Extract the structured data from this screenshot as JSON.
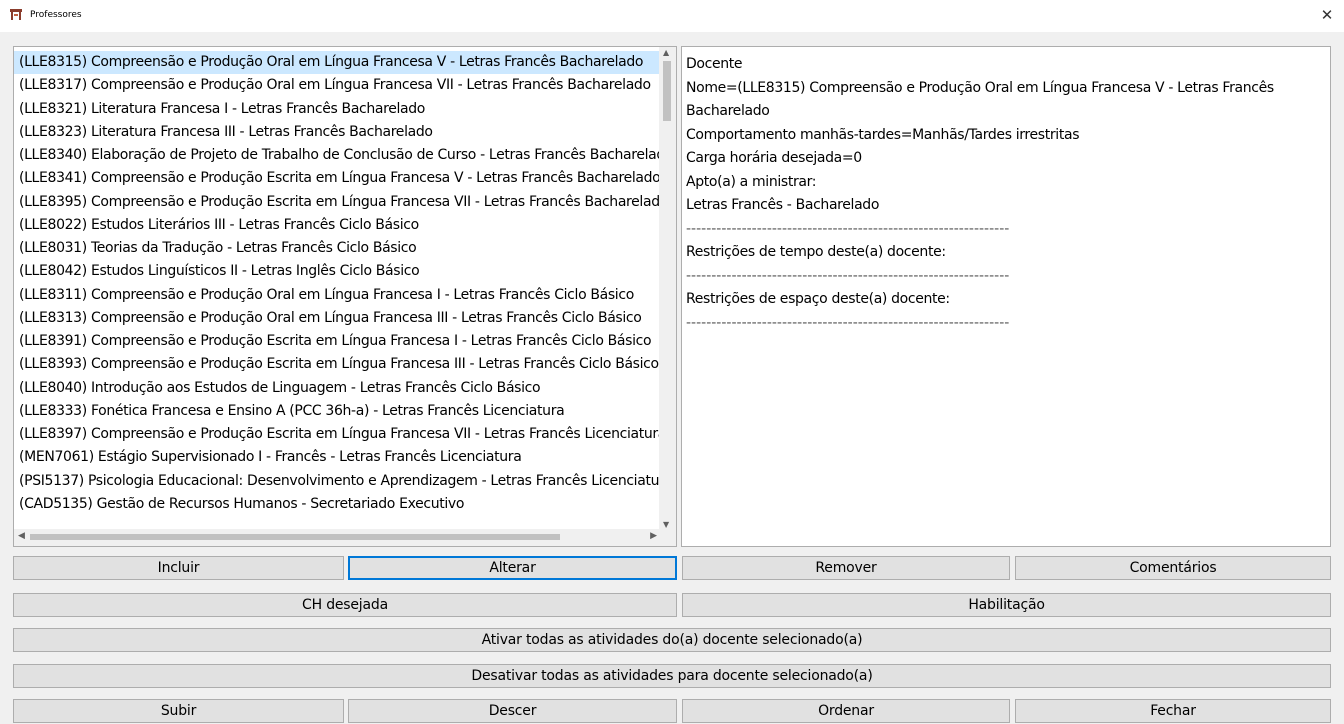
{
  "window": {
    "title": "Professores"
  },
  "list": {
    "items": [
      "(LLE8315) Compreensão e Produção Oral em Língua Francesa V - Letras Francês Bacharelado",
      "(LLE8317) Compreensão e Produção Oral em Língua Francesa VII - Letras Francês Bacharelado",
      "(LLE8321) Literatura Francesa I - Letras Francês Bacharelado",
      "(LLE8323) Literatura Francesa III - Letras Francês Bacharelado",
      "(LLE8340) Elaboração de Projeto de Trabalho de Conclusão de Curso - Letras Francês Bacharelado",
      "(LLE8341) Compreensão e Produção Escrita em Língua Francesa V - Letras Francês Bacharelado",
      "(LLE8395) Compreensão e Produção Escrita em Língua Francesa VII - Letras Francês Bacharelado",
      "(LLE8022) Estudos Literários III - Letras Francês Ciclo Básico",
      "(LLE8031) Teorias da Tradução - Letras Francês Ciclo Básico",
      "(LLE8042) Estudos Linguísticos II - Letras Inglês Ciclo Básico",
      "(LLE8311) Compreensão e Produção Oral em Língua Francesa I - Letras Francês Ciclo Básico",
      "(LLE8313) Compreensão e Produção Oral em Língua Francesa III - Letras Francês Ciclo Básico",
      "(LLE8391) Compreensão e Produção Escrita em Língua Francesa I - Letras Francês Ciclo Básico",
      "(LLE8393) Compreensão e Produção Escrita em Língua Francesa III - Letras Francês Ciclo Básico",
      "(LLE8040) Introdução aos Estudos de Linguagem - Letras Francês Ciclo Básico",
      "(LLE8333) Fonética Francesa e Ensino A (PCC 36h-a) - Letras Francês Licenciatura",
      "(LLE8397) Compreensão e Produção Escrita em Língua Francesa VII - Letras Francês Licenciatura",
      "(MEN7061) Estágio Supervisionado I - Francês - Letras Francês Licenciatura",
      "(PSI5137) Psicologia Educacional: Desenvolvimento e Aprendizagem - Letras Francês Licenciatura",
      "(CAD5135) Gestão de Recursos Humanos - Secretariado Executivo"
    ]
  },
  "details": {
    "lines": [
      "Docente",
      "Nome=(LLE8315) Compreensão e Produção Oral em Língua Francesa V - Letras Francês",
      "Bacharelado",
      "Comportamento manhãs-tardes=Manhãs/Tardes irrestritas",
      "Carga horária desejada=0",
      "Apto(a) a ministrar:",
      "Letras Francês - Bacharelado",
      "----------------------------------------------------------------",
      "Restrições de tempo deste(a) docente:",
      "----------------------------------------------------------------",
      "Restrições de espaço deste(a) docente:",
      "----------------------------------------------------------------"
    ]
  },
  "buttons": {
    "incluir": "Incluir",
    "alterar": "Alterar",
    "remover": "Remover",
    "comentarios": "Comentários",
    "ch_desejada": "CH desejada",
    "habilitacao": "Habilitação",
    "ativar": "Ativar todas as atividades do(a) docente selecionado(a)",
    "desativar": "Desativar todas as atividades para docente selecionado(a)",
    "subir": "Subir",
    "descer": "Descer",
    "ordenar": "Ordenar",
    "fechar": "Fechar"
  }
}
